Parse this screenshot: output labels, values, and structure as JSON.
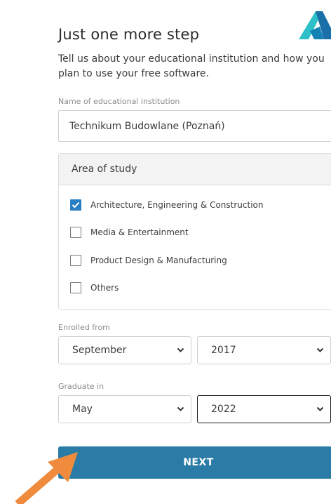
{
  "header": {
    "title": "Just one more step",
    "logo_icon": "autodesk-logo",
    "logo_color": "#1fa5c8"
  },
  "intro": {
    "text": "Tell us about your educational institution and how you plan to use your free software."
  },
  "institution": {
    "label": "Name of educational institution",
    "value": "Technikum Budowlane (Poznań)"
  },
  "area_of_study": {
    "header": "Area of study",
    "options": [
      {
        "label": "Architecture, Engineering & Construction",
        "checked": true
      },
      {
        "label": "Media & Entertainment",
        "checked": false
      },
      {
        "label": "Product Design & Manufacturing",
        "checked": false
      },
      {
        "label": "Others",
        "checked": false
      }
    ]
  },
  "enrolled": {
    "label": "Enrolled from",
    "month": "September",
    "year": "2017"
  },
  "graduate": {
    "label": "Graduate in",
    "month": "May",
    "year": "2022"
  },
  "next_button": {
    "label": "NEXT",
    "color": "#2a7ca6"
  },
  "annotation": {
    "arrow_icon": "orange-arrow-icon",
    "arrow_color": "#f08a3c"
  },
  "colors": {
    "checkbox_checked": "#2a7ec4"
  }
}
